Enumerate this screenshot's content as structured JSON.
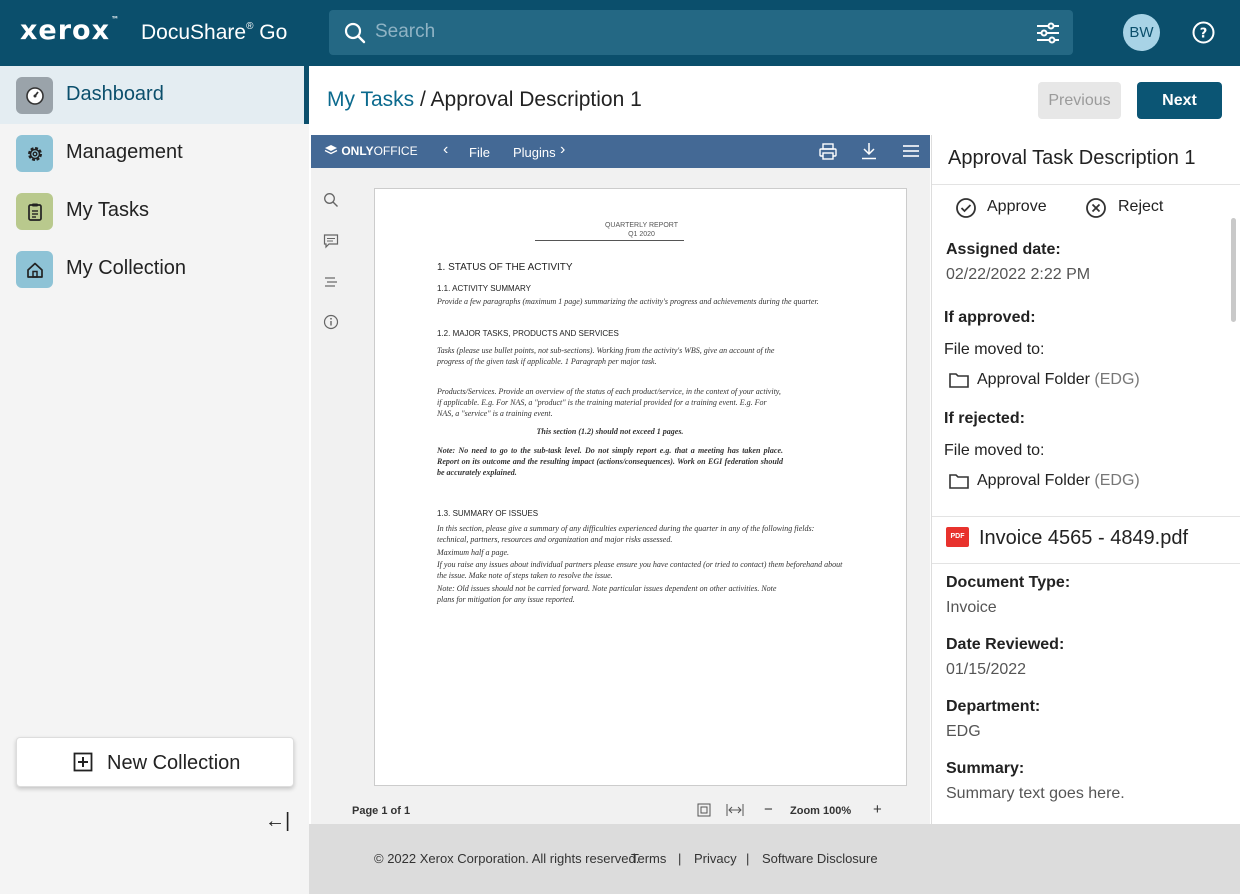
{
  "header": {
    "logo": "xerox",
    "product": "DocuShare",
    "product_suffix": "Go",
    "search_placeholder": "Search",
    "avatar_initials": "BW",
    "colors": {
      "topbar": "#0b4f6c",
      "accent": "#0b5574"
    }
  },
  "sidebar": {
    "items": [
      {
        "label": "Dashboard",
        "icon": "gauge-icon",
        "active": true
      },
      {
        "label": "Management",
        "icon": "gear-icon"
      },
      {
        "label": "My Tasks",
        "icon": "clipboard-icon"
      },
      {
        "label": "My Collection",
        "icon": "home-icon"
      }
    ],
    "new_collection": "New Collection",
    "collapse_glyph": "←|"
  },
  "breadcrumb": {
    "parent": "My Tasks",
    "separator": "/",
    "current": "Approval Description 1"
  },
  "actions": {
    "previous": "Previous",
    "next": "Next"
  },
  "editor": {
    "brand": "ONLY",
    "brand_suffix": "OFFICE",
    "menu": [
      "File",
      "Plugins"
    ],
    "page_info": "Page 1 of 1",
    "zoom": "Zoom 100%",
    "document": {
      "title": "QUARTERLY REPORT",
      "subtitle": "Q1 2020",
      "s1": "1. STATUS OF THE ACTIVITY",
      "s11": "1.1. ACTIVITY SUMMARY",
      "p11": "Provide a few paragraphs (maximum 1 page) summarizing the activity's progress and achievements during the quarter.",
      "s12": "1.2. MAJOR TASKS, PRODUCTS AND SERVICES",
      "p12a": "Tasks (please use bullet points, not sub-sections). Working from the activity's WBS, give an account of the progress of the given task if applicable. 1 Paragraph per major task.",
      "p12b": "Products/Services. Provide an overview of the status of each product/service, in the context of your activity, if applicable. E.g. For NAS, a \"product\" is the training material provided for a training event. E.g. For NAS, a \"service\" is a training event.",
      "p12c": "This section (1.2) should not exceed 1 pages.",
      "p12d": "Note: No need to go to the sub-task level. Do not simply report e.g. that a meeting has taken place. Report on its outcome and the resulting impact (actions/consequences). Work on EGI federation should be accurately explained.",
      "s13": "1.3. SUMMARY OF ISSUES",
      "p13a": "In this section, please give a summary of any difficulties experienced during the quarter in any of the following fields: technical, partners, resources and organization and major risks assessed.",
      "p13b": "Maximum half a page.",
      "p13c": "If you raise any issues about individual partners please ensure you have contacted (or tried to contact) them beforehand about the issue. Make note of steps taken to resolve the issue.",
      "p13d": "Note: Old issues should not be carried forward. Note particular issues dependent on other activities. Note plans for mitigation for any issue reported."
    }
  },
  "task_panel": {
    "title": "Approval Task Description 1",
    "approve": "Approve",
    "reject": "Reject",
    "assigned_label": "Assigned date:",
    "assigned_value": "02/22/2022 2:22 PM",
    "approved_label": "If approved:",
    "approved_moved": "File moved to:",
    "approved_folder": "Approval Folder",
    "approved_folder_suffix": "(EDG)",
    "rejected_label": "If rejected:",
    "rejected_moved": "File moved to:",
    "rejected_folder": "Approval Folder",
    "rejected_folder_suffix": "(EDG)",
    "file_name": "Invoice 4565 - 4849.pdf",
    "pdf_badge": "PDF",
    "fields": [
      {
        "label": "Document Type:",
        "value": "Invoice"
      },
      {
        "label": "Date Reviewed:",
        "value": "01/15/2022"
      },
      {
        "label": "Department:",
        "value": "EDG"
      },
      {
        "label": "Summary:",
        "value": "Summary text goes here."
      }
    ]
  },
  "footer": {
    "copyright": "© 2022 Xerox Corporation. All rights reserved.",
    "sep": "|",
    "links": [
      "Terms",
      "Privacy",
      "Software Disclosure"
    ]
  }
}
